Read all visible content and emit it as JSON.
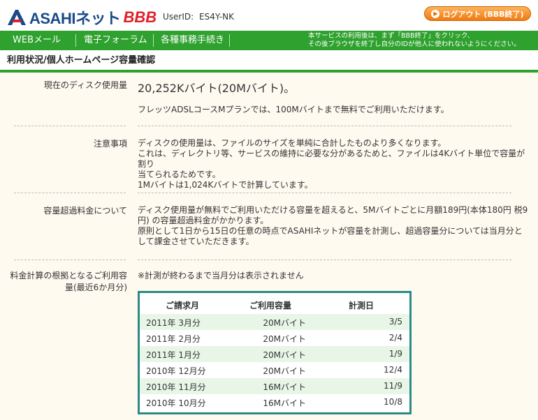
{
  "header": {
    "logo_text": "ASAHIネット",
    "logo_bbb": "BBB",
    "userid_label": "UserID:",
    "userid_value": "ES4Y-NK",
    "logout_label": "ログアウト (BBB終了)"
  },
  "nav": {
    "items": [
      "WEBメール",
      "電子フォーラム",
      "各種事務手続き"
    ],
    "note_line1": "本サービスの利用後は、まず「BBB終了」をクリック、",
    "note_line2": "その後ブラウザを終了し自分のIDが他人に使われないようにください。"
  },
  "page": {
    "title": "利用状況/個人ホームページ容量確認"
  },
  "sections": {
    "usage": {
      "label": "現在のディスク使用量",
      "value": "20,252Kバイト(20Mバイト)。",
      "note": "フレッツADSLコースMプランでは、100Mバイトまで無料でご利用いただけます。"
    },
    "caution": {
      "label": "注意事項",
      "line1": "ディスクの使用量は、ファイルのサイズを単純に合計したものより多くなります。",
      "line2": "これは、ディレクトリ等、サービスの維持に必要な分があるためと、ファイルは4Kバイト単位で容量が割り",
      "line3": "当てられるためです。",
      "line4": "1Mバイトは1,024Kバイトで計算しています。"
    },
    "overage": {
      "label": "容量超過料金について",
      "line1": "ディスク使用量が無料でご利用いただける容量を超えると、5Mバイトごとに月額189円(本体180円 税9",
      "line2": "円) の容量超過料金がかかります。",
      "line3": "原則として1日から15日の任意の時点でASAHIネットが容量を計測し、超過容量分については当月分と",
      "line4": "して課金させていただきます。"
    },
    "billing": {
      "label_line1": "料金計算の根拠となるご利用容",
      "label_line2": "量(最近6か月分)",
      "note": "※計測が終わるまで当月分は表示されません"
    }
  },
  "table": {
    "headers": [
      "ご請求月",
      "ご利用容量",
      "計測日"
    ],
    "rows": [
      [
        "2011年 3月分",
        "20Mバイト",
        "3/5"
      ],
      [
        "2011年 2月分",
        "20Mバイト",
        "2/4"
      ],
      [
        "2011年 1月分",
        "20Mバイト",
        "1/9"
      ],
      [
        "2010年 12月分",
        "20Mバイト",
        "12/4"
      ],
      [
        "2010年 11月分",
        "16Mバイト",
        "11/9"
      ],
      [
        "2010年 10月分",
        "16Mバイト",
        "10/8"
      ]
    ]
  },
  "colors": {
    "brand_green": "#2ea12e",
    "logo_blue": "#1a4a8a",
    "logo_red": "#e0202a",
    "logout_orange": "#f07a10",
    "table_border": "#2a8b84",
    "content_bg": "#fffaf0"
  }
}
